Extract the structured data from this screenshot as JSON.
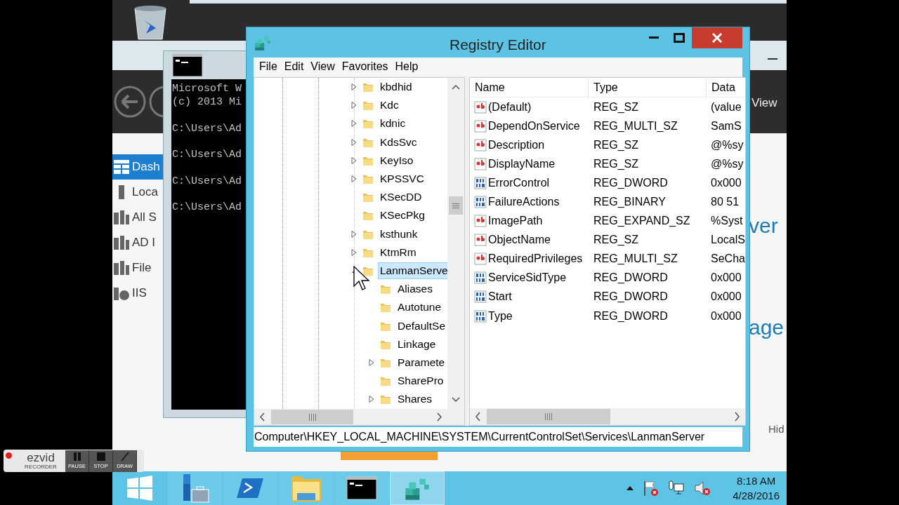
{
  "server_manager": {
    "nav": [
      {
        "label": "Dash",
        "selected": true,
        "kind": "dashboard"
      },
      {
        "label": "Loca",
        "selected": false,
        "kind": "server"
      },
      {
        "label": "All S",
        "selected": false,
        "kind": "servers"
      },
      {
        "label": "AD I",
        "selected": false,
        "kind": "ad"
      },
      {
        "label": "File",
        "selected": false,
        "kind": "file"
      },
      {
        "label": "IIS",
        "selected": false,
        "kind": "iis"
      }
    ],
    "header_link": "View",
    "fragments": [
      {
        "kind": "heading",
        "text": "ver"
      },
      {
        "kind": "heading",
        "text": "age"
      },
      {
        "kind": "link",
        "text": "Hid"
      }
    ]
  },
  "console": {
    "header": [
      "Microsoft W",
      "(c) 2013 Mi"
    ],
    "prompts": [
      "C:\\Users\\Ad",
      "C:\\Users\\Ad",
      "C:\\Users\\Ad",
      "C:\\Users\\Ad"
    ]
  },
  "registry_editor": {
    "title": "Registry Editor",
    "menu": [
      "File",
      "Edit",
      "View",
      "Favorites",
      "Help"
    ],
    "tree": [
      {
        "label": "kbdhid",
        "has_children": true,
        "expanded": false,
        "selected": false
      },
      {
        "label": "Kdc",
        "has_children": true,
        "expanded": false,
        "selected": false
      },
      {
        "label": "kdnic",
        "has_children": true,
        "expanded": false,
        "selected": false
      },
      {
        "label": "KdsSvc",
        "has_children": true,
        "expanded": false,
        "selected": false
      },
      {
        "label": "KeyIso",
        "has_children": true,
        "expanded": false,
        "selected": false
      },
      {
        "label": "KPSSVC",
        "has_children": true,
        "expanded": false,
        "selected": false
      },
      {
        "label": "KSecDD",
        "has_children": false,
        "selected": false
      },
      {
        "label": "KSecPkg",
        "has_children": false,
        "selected": false
      },
      {
        "label": "ksthunk",
        "has_children": true,
        "expanded": false,
        "selected": false
      },
      {
        "label": "KtmRm",
        "has_children": true,
        "expanded": false,
        "selected": false
      },
      {
        "label": "LanmanServe",
        "has_children": true,
        "expanded": true,
        "selected": true,
        "children": [
          {
            "label": "Aliases",
            "has_children": false,
            "selected": false
          },
          {
            "label": "Autotune",
            "has_children": false,
            "selected": false
          },
          {
            "label": "DefaultSe",
            "has_children": false,
            "selected": false
          },
          {
            "label": "Linkage",
            "has_children": false,
            "selected": false
          },
          {
            "label": "Paramete",
            "has_children": true,
            "expanded": false,
            "selected": false
          },
          {
            "label": "SharePro",
            "has_children": false,
            "selected": false
          },
          {
            "label": "Shares",
            "has_children": true,
            "expanded": false,
            "selected": false
          }
        ]
      }
    ],
    "columns": [
      "Name",
      "Type",
      "Data"
    ],
    "values": [
      {
        "kind": "string",
        "name": "(Default)",
        "type": "REG_SZ",
        "data": "(value"
      },
      {
        "kind": "string",
        "name": "DependOnService",
        "type": "REG_MULTI_SZ",
        "data": "SamS"
      },
      {
        "kind": "string",
        "name": "Description",
        "type": "REG_SZ",
        "data": "@%sy"
      },
      {
        "kind": "string",
        "name": "DisplayName",
        "type": "REG_SZ",
        "data": "@%sy"
      },
      {
        "kind": "binary",
        "name": "ErrorControl",
        "type": "REG_DWORD",
        "data": "0x000"
      },
      {
        "kind": "binary",
        "name": "FailureActions",
        "type": "REG_BINARY",
        "data": "80 51"
      },
      {
        "kind": "string",
        "name": "ImagePath",
        "type": "REG_EXPAND_SZ",
        "data": "%Syst"
      },
      {
        "kind": "string",
        "name": "ObjectName",
        "type": "REG_SZ",
        "data": "LocalS"
      },
      {
        "kind": "string",
        "name": "RequiredPrivileges",
        "type": "REG_MULTI_SZ",
        "data": "SeCha"
      },
      {
        "kind": "binary",
        "name": "ServiceSidType",
        "type": "REG_DWORD",
        "data": "0x000"
      },
      {
        "kind": "binary",
        "name": "Start",
        "type": "REG_DWORD",
        "data": "0x000"
      },
      {
        "kind": "binary",
        "name": "Type",
        "type": "REG_DWORD",
        "data": "0x000"
      }
    ],
    "status_bar": "Computer\\HKEY_LOCAL_MACHINE\\SYSTEM\\CurrentControlSet\\Services\\LanmanServer"
  },
  "taskbar": {
    "apps": [
      {
        "kind": "start",
        "active": false
      },
      {
        "kind": "server-manager",
        "active": false
      },
      {
        "kind": "powershell",
        "active": false
      },
      {
        "kind": "explorer",
        "active": false
      },
      {
        "kind": "console",
        "active": false
      },
      {
        "kind": "registry",
        "active": true
      }
    ],
    "clock": {
      "time": "8:18 AM",
      "date": "4/28/2016"
    }
  },
  "recorder": {
    "brand": "ezvid",
    "subtitle": "RECORDER",
    "buttons": [
      {
        "kind": "pause",
        "label": "PAUSE"
      },
      {
        "kind": "stop",
        "label": "STOP"
      },
      {
        "kind": "draw",
        "label": "DRAW"
      }
    ]
  }
}
